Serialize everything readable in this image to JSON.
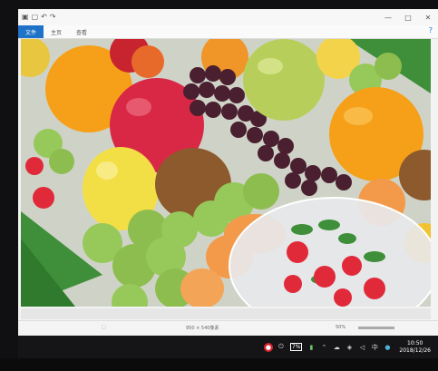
{
  "window": {
    "title": "",
    "quick_access": [
      "save-icon",
      "undo-icon",
      "redo-icon"
    ],
    "controls": [
      "minimize-icon",
      "maximize-icon",
      "close-icon"
    ],
    "help_icon": "help-icon"
  },
  "ribbon": {
    "tabs": [
      {
        "label": "文件",
        "active": true
      },
      {
        "label": "主页",
        "active": false
      },
      {
        "label": "查看",
        "active": false
      }
    ]
  },
  "canvas": {
    "image_description_colors": {
      "orange": "#f6a01a",
      "apple_red": "#d92846",
      "apple_green": "#b7cf5a",
      "grape": "#4a1f30",
      "lemon": "#f2df45",
      "kiwi": "#8c5a2d",
      "plum_green": "#96c85a",
      "strawberry": "#e02a3a",
      "leaf": "#3f8f3a",
      "bowl": "#e8e8ea"
    }
  },
  "statusbar": {
    "dimensions": "950 × 540像素",
    "zoom": "50%"
  },
  "taskbar": {
    "battery": "7%",
    "time": "10:50",
    "date": "2018/12/26",
    "tray_icons": [
      "record-icon",
      "power-icon",
      "chevron-up-icon",
      "cloud-icon",
      "network-icon",
      "volume-icon",
      "input-icon",
      "notification-icon"
    ]
  },
  "colors": {
    "accent": "#1e73c8",
    "taskbar": "#151517"
  }
}
